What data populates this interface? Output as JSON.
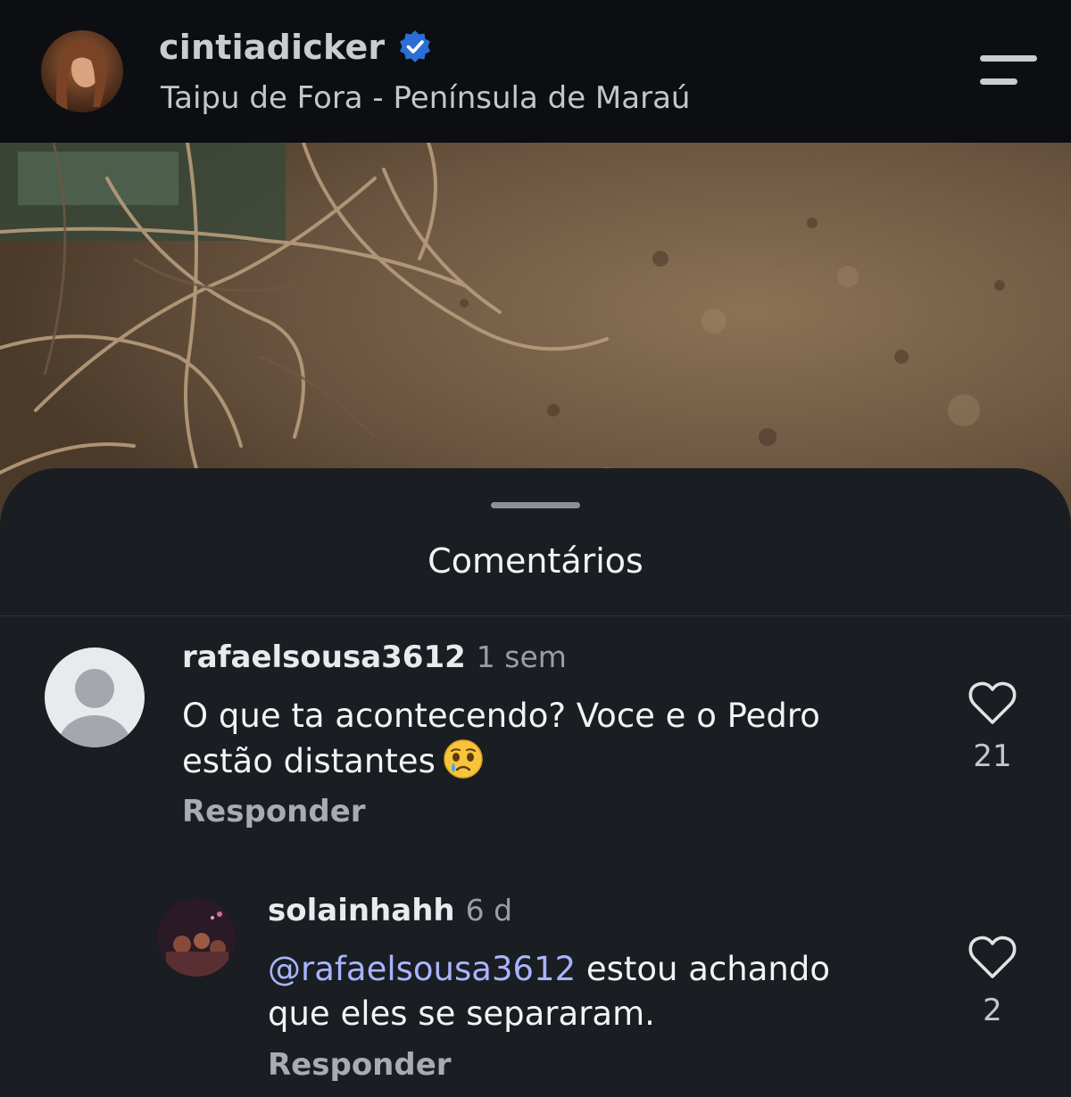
{
  "post": {
    "username": "cintiadicker",
    "verified": true,
    "location": "Taipu de Fora - Península de Maraú"
  },
  "icons": {
    "menu": "hamburger-menu-icon",
    "verified": "verified-badge-icon",
    "like": "heart-outline-icon",
    "emoji": "crying-face-emoji"
  },
  "colors": {
    "background": "#0c0e11",
    "sheet": "#1a1d22",
    "verified_badge": "#2b6fd6",
    "mention": "#a9b4ff"
  },
  "comments_sheet": {
    "title": "Comentários",
    "comments": [
      {
        "username": "rafaelsousa3612",
        "time": "1 sem",
        "text_part1": "O que ta acontecendo? Voce e o Pedro",
        "text_part2": "estão distantes",
        "emoji": "😢",
        "reply_label": "Responder",
        "likes": "21"
      },
      {
        "username": "solainhahh",
        "time": "6 d",
        "mention": "@rafaelsousa3612",
        "text_part1": " estou achando",
        "text_part2": "que eles se separaram.",
        "reply_label": "Responder",
        "likes": "2"
      }
    ]
  }
}
